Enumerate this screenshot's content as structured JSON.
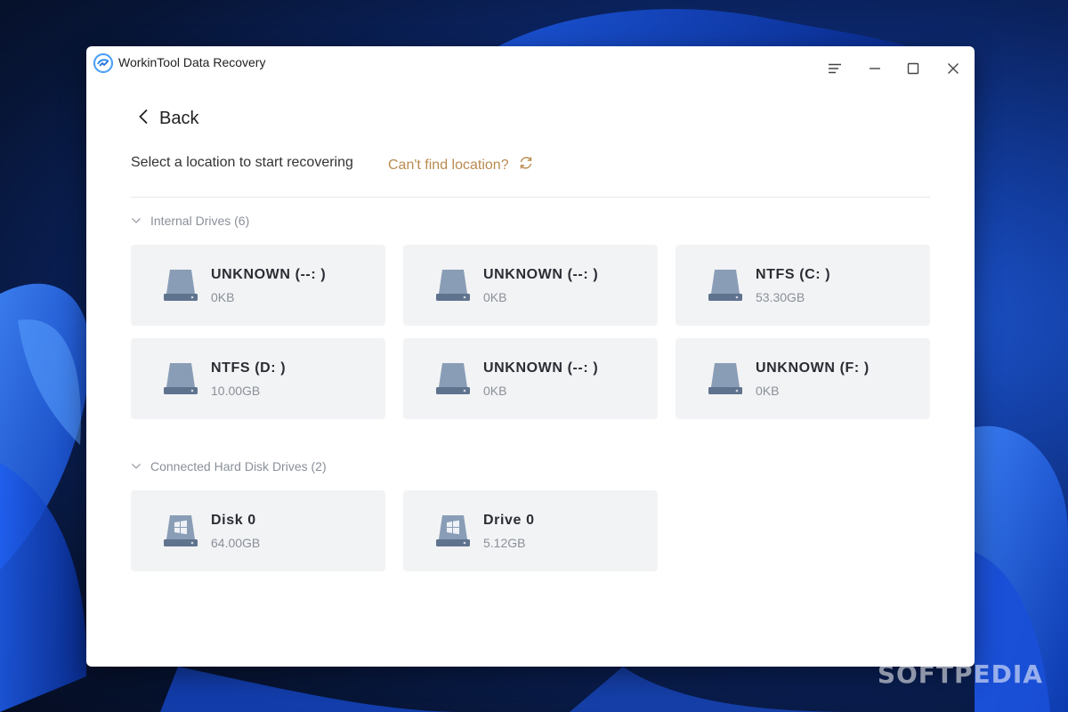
{
  "app": {
    "title": "WorkinTool Data Recovery"
  },
  "nav": {
    "back_label": "Back"
  },
  "header": {
    "instruction": "Select a location to start recovering",
    "cant_find": "Can't find location?"
  },
  "internal": {
    "label": "Internal Drives (6)",
    "drives": [
      {
        "name": "UNKNOWN (--: )",
        "size": "0KB"
      },
      {
        "name": "UNKNOWN (--: )",
        "size": "0KB"
      },
      {
        "name": "NTFS (C: )",
        "size": "53.30GB"
      },
      {
        "name": "NTFS (D: )",
        "size": "10.00GB"
      },
      {
        "name": "UNKNOWN (--: )",
        "size": "0KB"
      },
      {
        "name": "UNKNOWN (F: )",
        "size": "0KB"
      }
    ]
  },
  "connected": {
    "label": "Connected Hard Disk Drives (2)",
    "drives": [
      {
        "name": "Disk 0",
        "size": "64.00GB"
      },
      {
        "name": "Drive 0",
        "size": "5.12GB"
      }
    ]
  },
  "watermark": "SOFTPEDIA",
  "colors": {
    "accent_link": "#b98b4f",
    "card_bg": "#f2f3f5",
    "drive_icon": "#7f93ad"
  },
  "icons": {
    "menu": "hamburger-menu-icon",
    "minimize": "minimize-icon",
    "maximize": "maximize-icon",
    "close": "close-icon",
    "back": "chevron-left-icon",
    "refresh": "refresh-icon",
    "collapse": "chevron-down-icon",
    "drive": "hard-drive-icon",
    "windows_drive": "windows-drive-icon"
  }
}
